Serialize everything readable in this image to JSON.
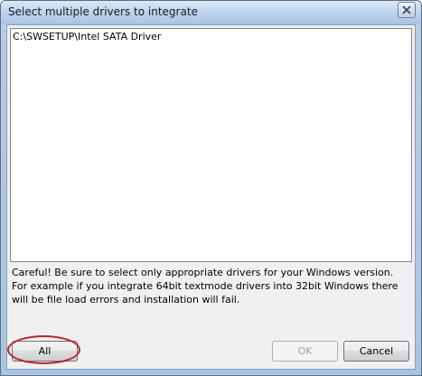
{
  "window": {
    "title": "Select multiple drivers to integrate",
    "close_glyph": "✕"
  },
  "driver_list": {
    "items": [
      "C:\\SWSETUP\\Intel SATA Driver"
    ]
  },
  "warning_text": "Careful! Be sure to select only appropriate drivers for your Windows version. For example if you integrate 64bit textmode drivers into 32bit Windows there will be file load errors and installation will fail.",
  "buttons": {
    "all_label": "All",
    "ok_label": "OK",
    "cancel_label": "Cancel",
    "ok_enabled": false
  },
  "colors": {
    "annotation": "#b8242a"
  }
}
